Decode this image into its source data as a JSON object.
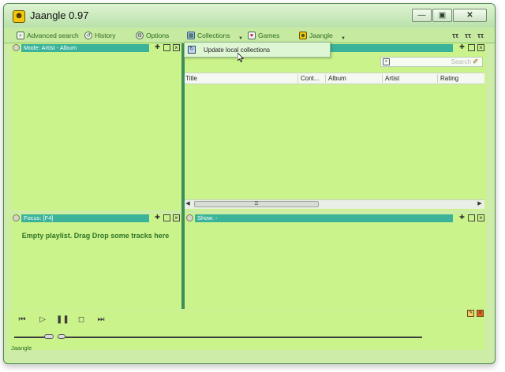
{
  "window": {
    "title": "Jaangle 0.97"
  },
  "toolbar": {
    "advanced_search": "Advanced search",
    "history": "History",
    "options": "Options",
    "collections": "Collections",
    "games": "Games",
    "jaangle": "Jaangle"
  },
  "collections_menu": {
    "item": "Update local collections"
  },
  "panels": {
    "mode": {
      "title": "Mode: Artist - Album"
    },
    "tracks": {
      "search_placeholder": "Search",
      "columns": [
        "Title",
        "Cont...",
        "Album",
        "Artist",
        "Rating"
      ]
    },
    "focus": {
      "title": "Focus: [F4]",
      "empty_text": "Empty playlist. Drag Drop some tracks here"
    },
    "show": {
      "title": "Show: -"
    }
  },
  "player": {
    "volume_fraction": 0.9,
    "position_fraction": 0.0
  },
  "status_bar": {
    "text": "Jaangle"
  }
}
